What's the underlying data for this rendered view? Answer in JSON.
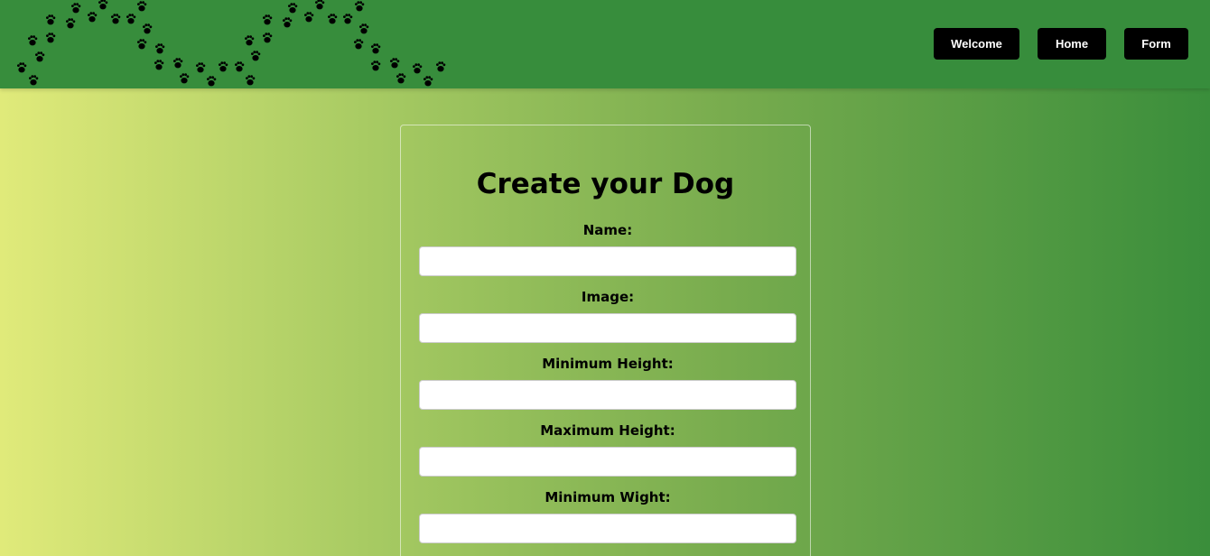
{
  "navbar": {
    "decoration": "paw-prints",
    "buttons": [
      {
        "label": "Welcome"
      },
      {
        "label": "Home"
      },
      {
        "label": "Form"
      }
    ]
  },
  "form": {
    "title": "Create your Dog",
    "fields": [
      {
        "label": "Name:",
        "value": ""
      },
      {
        "label": "Image:",
        "value": ""
      },
      {
        "label": "Minimum Height:",
        "value": ""
      },
      {
        "label": "Maximum Height:",
        "value": ""
      },
      {
        "label": "Minimum Wight:",
        "value": ""
      }
    ]
  },
  "colors": {
    "navbar": "#378d3c",
    "gradient_start": "#e0ea7a",
    "gradient_end": "#3a8e3b",
    "button_bg": "#000000",
    "button_text": "#ffffff"
  }
}
